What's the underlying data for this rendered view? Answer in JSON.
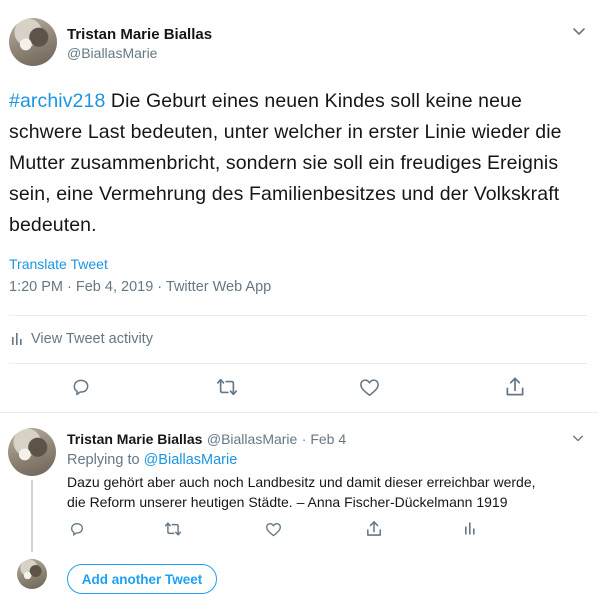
{
  "tweet": {
    "author_name": "Tristan Marie Biallas",
    "author_handle": "@BiallasMarie",
    "hashtag": "#archiv218",
    "body": " Die Geburt eines neuen Kindes soll keine neue schwere Last bedeuten, unter welcher in erster Linie wieder die Mutter zusammenbricht, sondern sie soll ein freudiges Ereignis sein, eine Vermehrung des Familienbesitzes und der Volkskraft bedeuten.",
    "translate_label": "Translate Tweet",
    "timestamp": "1:20 PM · Feb 4, 2019 · Twitter Web App",
    "activity_label": "View Tweet activity"
  },
  "icons": {
    "menu": "chevron-down-icon",
    "reply": "reply-icon",
    "retweet": "retweet-icon",
    "like": "heart-icon",
    "share": "share-icon",
    "activity": "bar-chart-icon"
  },
  "reply": {
    "author_name": "Tristan Marie Biallas",
    "author_handle": "@BiallasMarie",
    "date": "· Feb 4",
    "replying_prefix": "Replying to ",
    "replying_to": "@BiallasMarie",
    "text_line1": "Dazu gehört aber auch noch Landbesitz und damit dieser erreichbar werde,",
    "text_line2": "die Reform unserer heutigen Städte. – Anna Fischer-Dückelmann  1919"
  },
  "compose": {
    "add_button_label": "Add another Tweet"
  },
  "colors": {
    "accent": "#1da1f2",
    "link": "#1b95e0",
    "secondary_text": "#657786",
    "divider": "#e6ecf0"
  }
}
